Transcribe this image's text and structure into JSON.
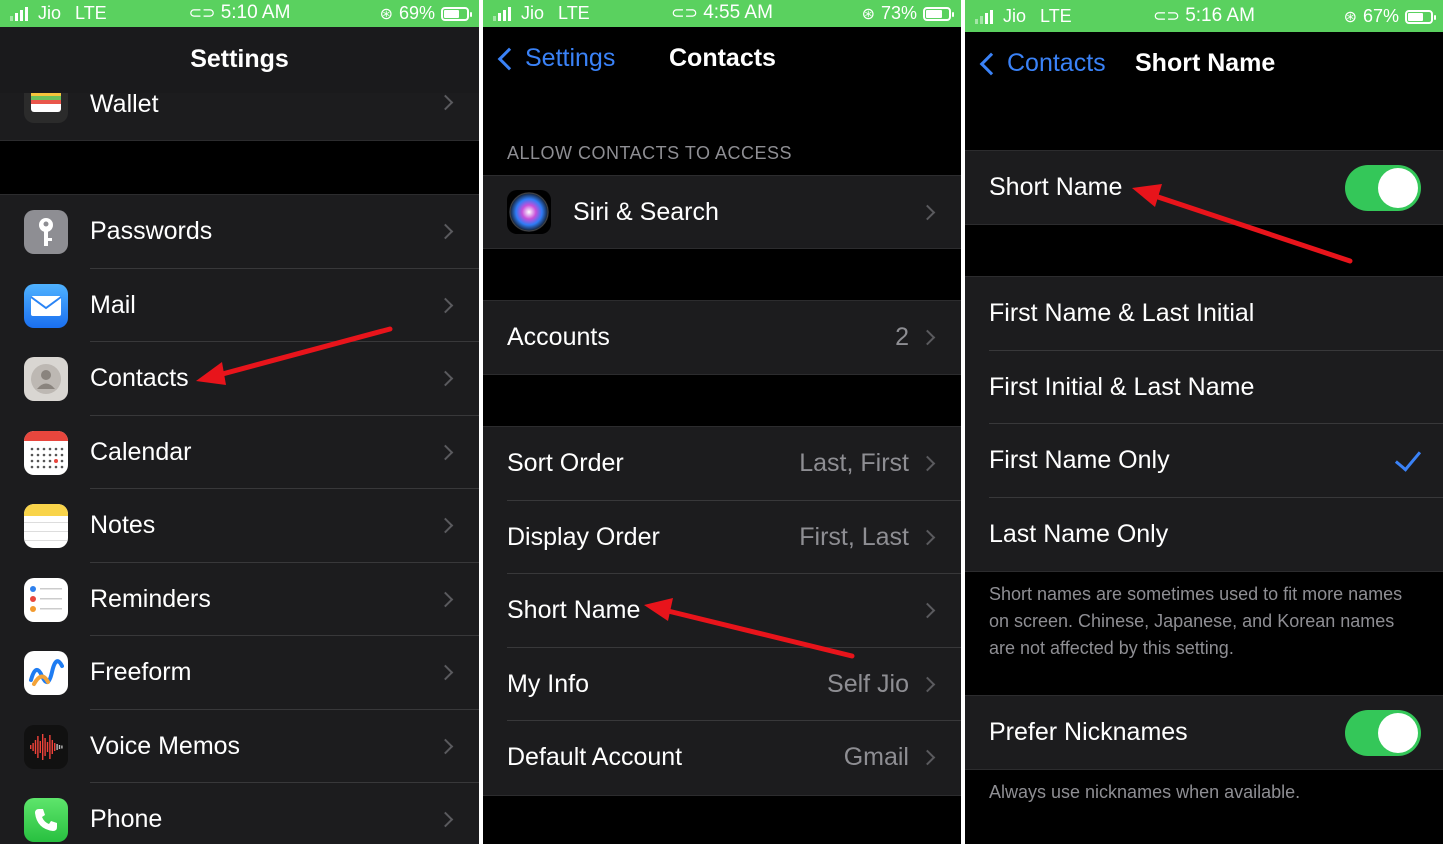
{
  "panel1": {
    "status": {
      "carrier": "Jio",
      "network": "LTE",
      "time": "5:10 AM",
      "battery": "69%",
      "battery_level": 0.69
    },
    "title": "Settings",
    "wallet_label": "Wallet",
    "items": [
      {
        "label": "Passwords",
        "icon": "key-icon"
      },
      {
        "label": "Mail",
        "icon": "envelope-icon"
      },
      {
        "label": "Contacts",
        "icon": "contacts-icon"
      },
      {
        "label": "Calendar",
        "icon": "calendar-icon"
      },
      {
        "label": "Notes",
        "icon": "notes-icon"
      },
      {
        "label": "Reminders",
        "icon": "reminders-icon"
      },
      {
        "label": "Freeform",
        "icon": "freeform-icon"
      },
      {
        "label": "Voice Memos",
        "icon": "waveform-icon"
      },
      {
        "label": "Phone",
        "icon": "phone-icon"
      }
    ]
  },
  "panel2": {
    "status": {
      "carrier": "Jio",
      "network": "LTE",
      "time": "4:55 AM",
      "battery": "73%",
      "battery_level": 0.73
    },
    "back_label": "Settings",
    "title": "Contacts",
    "section_header": "ALLOW CONTACTS TO ACCESS",
    "siri_label": "Siri & Search",
    "accounts": {
      "label": "Accounts",
      "value": "2"
    },
    "rows": [
      {
        "label": "Sort Order",
        "value": "Last, First"
      },
      {
        "label": "Display Order",
        "value": "First, Last"
      },
      {
        "label": "Short Name",
        "value": ""
      },
      {
        "label": "My Info",
        "value": "Self Jio"
      },
      {
        "label": "Default Account",
        "value": "Gmail"
      }
    ]
  },
  "panel3": {
    "status": {
      "carrier": "Jio",
      "network": "LTE",
      "time": "5:16 AM",
      "battery": "67%",
      "battery_level": 0.67
    },
    "back_label": "Contacts",
    "title": "Short Name",
    "short_name_label": "Short Name",
    "short_name_on": true,
    "options": [
      {
        "label": "First Name & Last Initial",
        "selected": false
      },
      {
        "label": "First Initial & Last Name",
        "selected": false
      },
      {
        "label": "First Name Only",
        "selected": true
      },
      {
        "label": "Last Name Only",
        "selected": false
      }
    ],
    "options_footer": "Short names are sometimes used to fit more names on screen. Chinese, Japanese, and Korean names are not affected by this setting.",
    "prefer_nicknames_label": "Prefer Nicknames",
    "prefer_nicknames_on": true,
    "nicknames_footer": "Always use nicknames when available."
  },
  "colors": {
    "status_bar": "#5ad15f",
    "accent": "#3a82f7",
    "toggle_on": "#34c759",
    "annotation_arrow": "#e8141b"
  }
}
